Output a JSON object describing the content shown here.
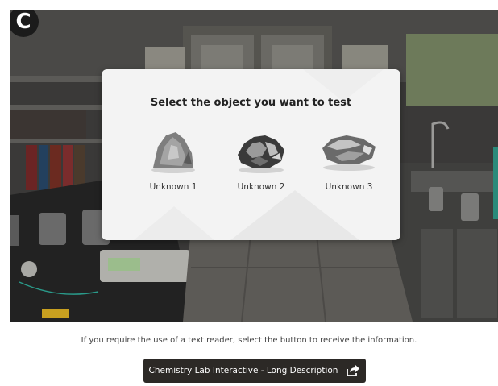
{
  "app": {
    "logo_glyph": "C"
  },
  "modal": {
    "title": "Select the object you want to test",
    "options": [
      {
        "label": "Unknown 1",
        "icon": "rock-icon"
      },
      {
        "label": "Unknown 2",
        "icon": "rock-icon"
      },
      {
        "label": "Unknown 3",
        "icon": "rock-icon"
      }
    ]
  },
  "footer": {
    "instructions": "If you require the use of a text reader, select the button to receive the information.",
    "button_label": "Chemistry Lab Interactive - Long Description",
    "button_icon": "share-arrow-icon"
  },
  "colors": {
    "modal_bg": "#f3f3f3",
    "button_bg": "#2c2926",
    "scene_dark": "#2a2a2a"
  }
}
